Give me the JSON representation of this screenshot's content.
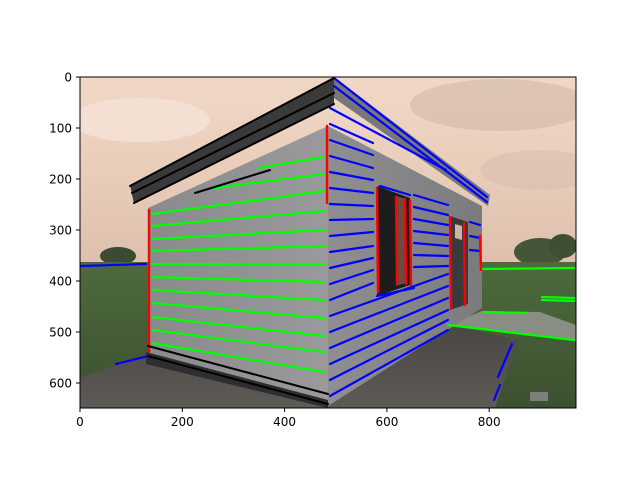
{
  "figure": {
    "x_axis": {
      "ticks": [
        0,
        200,
        400,
        600,
        800
      ],
      "range": [
        0,
        970
      ]
    },
    "y_axis": {
      "ticks": [
        0,
        100,
        200,
        300,
        400,
        500,
        600
      ],
      "range": [
        0,
        650
      ],
      "inverted": true
    }
  },
  "line_colors": {
    "horizontal": "#00ff00",
    "depth": "#0000ff",
    "vertical": "#ff0000"
  },
  "scene": "shed with overlaid detected line segments"
}
